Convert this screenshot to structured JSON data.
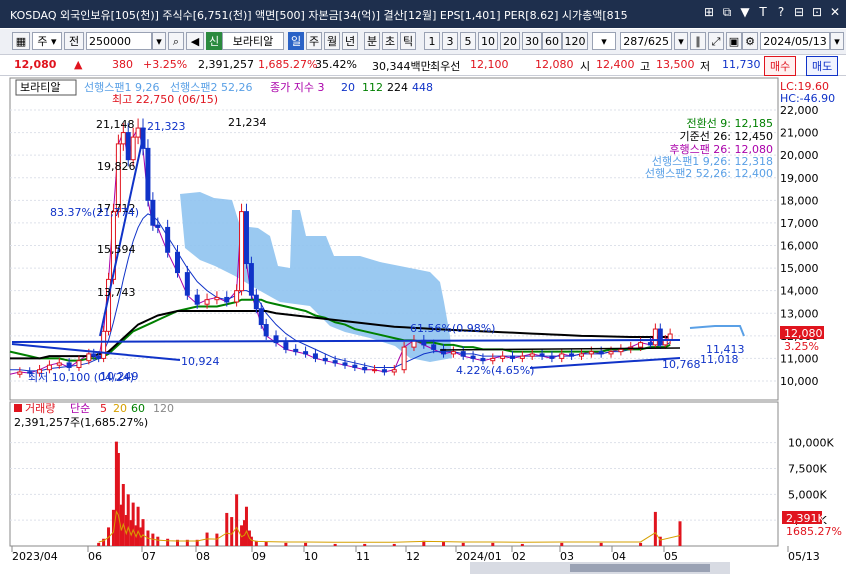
{
  "title": "KOSDAQ 외국인보유[105(천)] 주식수[6,751(천)] 액면[500] 자본금[34(억)] 결산[12월] EPS[1,401] PER[8.62] 시가총액[815",
  "title_icons": [
    "⊞",
    "⧉",
    "▼",
    "T",
    "?",
    "⊟",
    "⊡",
    "✕"
  ],
  "toolbar": {
    "left_icon": "chart-icon",
    "period": "주",
    "prev": "전",
    "code": "250000",
    "badge": "신",
    "name": "보라티알",
    "period_buttons": [
      "일",
      "주",
      "월",
      "년",
      "분",
      "초",
      "틱"
    ],
    "selected_period": "일",
    "minute_buttons": [
      "1",
      "3",
      "5",
      "10",
      "20",
      "30",
      "60",
      "120"
    ],
    "page": "287",
    "page_total": "/625",
    "date": "2024/05/13"
  },
  "quote": {
    "price": "12,080",
    "change": "380",
    "change_rate": "+3.25%",
    "volume": "2,391,257",
    "volume_rate": "1,685.27%",
    "turnover": "35.42%",
    "amount": "30,344백만",
    "best_ask_label": "최우선",
    "best_ask": "12,100",
    "best_bid": "12,080",
    "open_label": "시",
    "open": "12,400",
    "high_label": "고",
    "high": "13,500",
    "low_label": "저",
    "low": "11,730",
    "buy": "매수",
    "sell": "매도"
  },
  "price_panel": {
    "stock_tag": "보라티알",
    "legend": [
      "선행스팬1 9,26",
      "선행스팬2 52,26",
      "종가 지수 3",
      "20",
      "112",
      "224",
      "448"
    ],
    "lc": "LC:19.60",
    "hc": "HC:-46.90",
    "ichimoku": [
      {
        "name": "전환선 9: 12,185",
        "color": "#008000"
      },
      {
        "name": "기준선 26: 12,450",
        "color": "#000000"
      },
      {
        "name": "후행스팬 26: 12,080",
        "color": "#aa00aa"
      },
      {
        "name": "선행스팬1 9,26: 12,318",
        "color": "#5aa0e6"
      },
      {
        "name": "선행스팬2 52,26: 12,400",
        "color": "#5aa0e6"
      }
    ],
    "annotations": {
      "high": "최고 22,750 (06/15)",
      "low": "최저 10,100 (04/24)",
      "a1": "21,148",
      "a2": "21,323",
      "a3": "21,234",
      "a4": "19,826",
      "a5": "17,712",
      "a6": "15,594",
      "a7": "13,743",
      "a8": "83.37%(21,774)",
      "a9": "10,924",
      "a10": "10,249",
      "a11": "4.22%(4.65%)",
      "a12": "11,413",
      "a13": "10,768",
      "a14": "11,018",
      "a15": "61.56%(0.98%)"
    },
    "price_tag": "12,080",
    "price_pct": "3.25%"
  },
  "volume_panel": {
    "legend": [
      "거래량",
      "단순",
      "5",
      "20",
      "60",
      "120"
    ],
    "value_line": "2,391,257주(1,685.27%)",
    "tag": "2,391K",
    "tag_pct": "1685.27%"
  },
  "x_labels": [
    "2023/04",
    "06",
    "07",
    "08",
    "09",
    "10",
    "11",
    "12",
    "2024/01",
    "02",
    "03",
    "04",
    "05",
    "05/13"
  ],
  "chart_data": [
    {
      "type": "line",
      "title": "",
      "ylim": [
        10000,
        22750
      ],
      "y_ticks": [
        10000,
        11000,
        12000,
        13000,
        14000,
        15000,
        16000,
        17000,
        18000,
        19000,
        20000,
        21000,
        22000
      ],
      "x": [
        0,
        10,
        20,
        30,
        40,
        50,
        60,
        70,
        80,
        85,
        90,
        95,
        100,
        105,
        110,
        115,
        120,
        125,
        130,
        135,
        140,
        145,
        150,
        160,
        170,
        180,
        190,
        200,
        210,
        220,
        230,
        235,
        240,
        245,
        250,
        255,
        260,
        270,
        280,
        290,
        300,
        310,
        320,
        330,
        340,
        350,
        360,
        370,
        380,
        390,
        400,
        410,
        420,
        430,
        440,
        450,
        460,
        470,
        480,
        490,
        500,
        510,
        520,
        530,
        540,
        550,
        560,
        570,
        580,
        590,
        600,
        610,
        620,
        630,
        640,
        650,
        655,
        660,
        665,
        670
      ],
      "series": [
        {
          "name": "종가",
          "values": [
            10300,
            10400,
            10350,
            10500,
            10700,
            10800,
            10600,
            10900,
            11200,
            11100,
            11000,
            12200,
            14500,
            17500,
            20500,
            21000,
            19800,
            20800,
            21200,
            20300,
            18000,
            16900,
            16800,
            15700,
            14800,
            13800,
            13400,
            13600,
            13700,
            13500,
            14000,
            17500,
            15200,
            13800,
            13200,
            12500,
            12000,
            11700,
            11400,
            11300,
            11200,
            11000,
            10900,
            10800,
            10700,
            10600,
            10500,
            10500,
            10400,
            10500,
            11500,
            11800,
            11600,
            11400,
            11200,
            11300,
            11100,
            11000,
            10900,
            11000,
            11100,
            11000,
            11100,
            11200,
            11100,
            11000,
            11200,
            11100,
            11200,
            11300,
            11200,
            11300,
            11400,
            11500,
            11700,
            11600,
            12300,
            11600,
            11800,
            12080
          ]
        },
        {
          "name": "20",
          "values": [
            10500,
            10500,
            10450,
            10450,
            10550,
            10600,
            10650,
            10700,
            10800,
            10900,
            11000,
            11300,
            11800,
            12600,
            13500,
            14500,
            15400,
            16200,
            16800,
            17200,
            17400,
            17300,
            17100,
            16400,
            15700,
            15000,
            14400,
            14000,
            13700,
            13600,
            13800,
            14000,
            14000,
            13900,
            13700,
            13400,
            13000,
            12500,
            12100,
            11800,
            11600,
            11400,
            11200,
            11000,
            10900,
            10800,
            10700,
            10600,
            10600,
            10600,
            10800,
            11000,
            11200,
            11300,
            11300,
            11300,
            11200,
            11200,
            11100,
            11100,
            11100,
            11100,
            11100,
            11100,
            11100,
            11100,
            11100,
            11100,
            11200,
            11200,
            11200,
            11300,
            11300,
            11400,
            11400,
            11500,
            11500,
            11600,
            11600,
            11700
          ]
        },
        {
          "name": "112",
          "values": [
            11300,
            11200,
            11100,
            11000,
            11000,
            11000,
            10900,
            10900,
            11000,
            11000,
            11000,
            11100,
            11200,
            11400,
            11600,
            11800,
            12000,
            12200,
            12300,
            12400,
            12500,
            12600,
            12700,
            12900,
            13100,
            13200,
            13300,
            13300,
            13300,
            13400,
            13500,
            13600,
            13600,
            13600,
            13600,
            13600,
            13500,
            13400,
            13300,
            13200,
            13100,
            12900,
            12800,
            12600,
            12500,
            12300,
            12200,
            12100,
            12000,
            11900,
            11800,
            11800,
            11700,
            11700,
            11600,
            11600,
            11500,
            11500,
            11400,
            11400,
            11400,
            11300,
            11300,
            11300,
            11300,
            11300,
            11300,
            11300,
            11300,
            11300,
            11300,
            11400,
            11400,
            11400,
            11400,
            11500,
            11500,
            11500,
            11500,
            11600
          ]
        },
        {
          "name": "224",
          "values": [
            11000,
            11000,
            11000,
            11000,
            11100,
            11100,
            11100,
            11100,
            11100,
            11100,
            11200,
            11200,
            11300,
            11500,
            11700,
            11900,
            12100,
            12300,
            12500,
            12600,
            12700,
            12800,
            12900,
            13000,
            13100,
            13100,
            13100,
            13100,
            13100,
            13100,
            13100,
            13100,
            13100,
            13100,
            13100,
            13100,
            13100,
            13000,
            12950,
            12900,
            12850,
            12800,
            12750,
            12700,
            12650,
            12600,
            12550,
            12500,
            12450,
            12400,
            12380,
            12350,
            12330,
            12300,
            12280,
            12260,
            12240,
            12220,
            12200,
            12180,
            12160,
            12140,
            12120,
            12100,
            12080,
            12060,
            12040,
            12020,
            12000,
            11990,
            11980,
            11970,
            11960,
            11950,
            11950,
            11950,
            11950,
            11950,
            11950,
            11950
          ]
        }
      ]
    },
    {
      "type": "bar",
      "title": "",
      "ylim": [
        0,
        12000
      ],
      "y_ticks": [
        "10,000K",
        "7,500K",
        "5,000K",
        "2,500K"
      ],
      "x": [
        90,
        95,
        100,
        105,
        108,
        110,
        113,
        115,
        118,
        120,
        123,
        125,
        128,
        130,
        133,
        135,
        140,
        145,
        150,
        160,
        170,
        180,
        190,
        200,
        210,
        220,
        225,
        230,
        235,
        238,
        240,
        243,
        245,
        250,
        260,
        280,
        300,
        330,
        360,
        390,
        420,
        440,
        460,
        490,
        520,
        560,
        600,
        640,
        655,
        660,
        680
      ],
      "values": [
        300,
        700,
        1800,
        3500,
        10100,
        9000,
        4000,
        6000,
        3000,
        5000,
        2500,
        4200,
        2000,
        3800,
        1800,
        2600,
        1500,
        1200,
        900,
        700,
        600,
        600,
        600,
        1300,
        1200,
        3200,
        2800,
        5000,
        2000,
        2500,
        3800,
        1500,
        900,
        500,
        400,
        300,
        300,
        200,
        200,
        200,
        500,
        400,
        300,
        300,
        200,
        300,
        300,
        300,
        3300,
        900,
        2391
      ]
    }
  ]
}
